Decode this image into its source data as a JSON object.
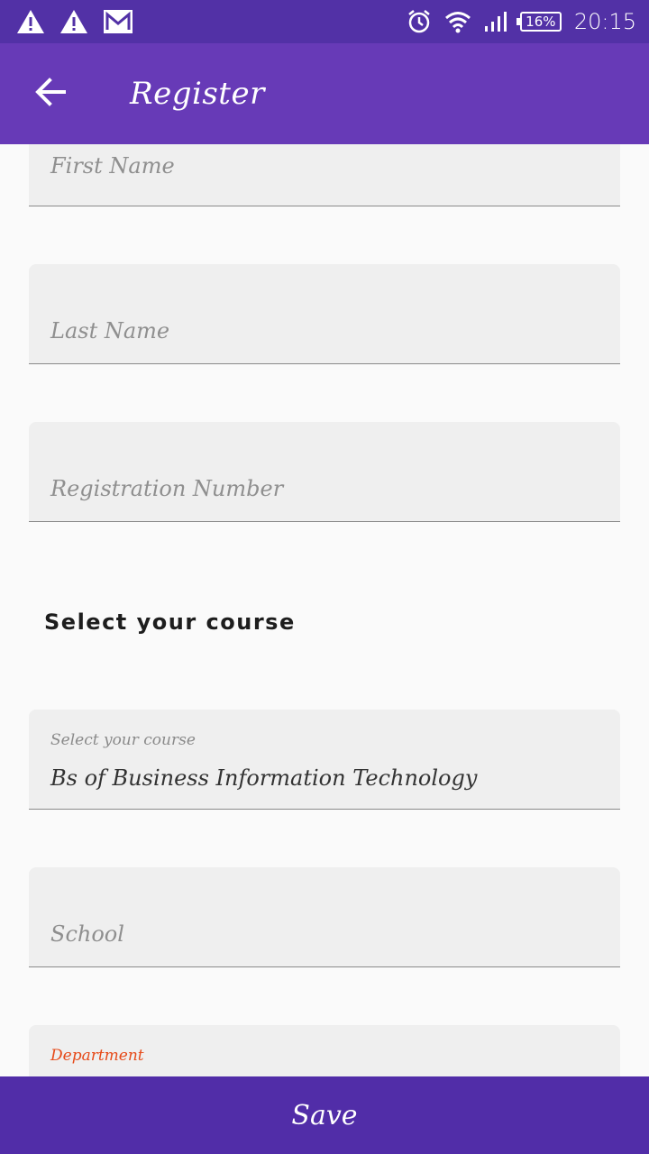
{
  "status_bar": {
    "left_icons": [
      "warning-icon",
      "warning-icon",
      "gmail-icon"
    ],
    "right_icons": [
      "alarm-icon",
      "wifi-icon",
      "signal-icon",
      "battery-icon"
    ],
    "battery": "16%",
    "time": "20:15"
  },
  "app_bar": {
    "title": "Register",
    "back_icon": "arrow-left-icon",
    "color": "#673ab7"
  },
  "form": {
    "first_name": {
      "placeholder": "First Name"
    },
    "last_name": {
      "placeholder": "Last Name"
    },
    "registration_number": {
      "placeholder": "Registration Number"
    },
    "course_section_heading": "Select your course",
    "course": {
      "label": "Select your course",
      "value": "Bs of Business Information Technology"
    },
    "school": {
      "placeholder": "School"
    },
    "department": {
      "label": "Department",
      "label_color": "#e64a19"
    }
  },
  "save_button": {
    "label": "Save",
    "color": "#512da8"
  }
}
